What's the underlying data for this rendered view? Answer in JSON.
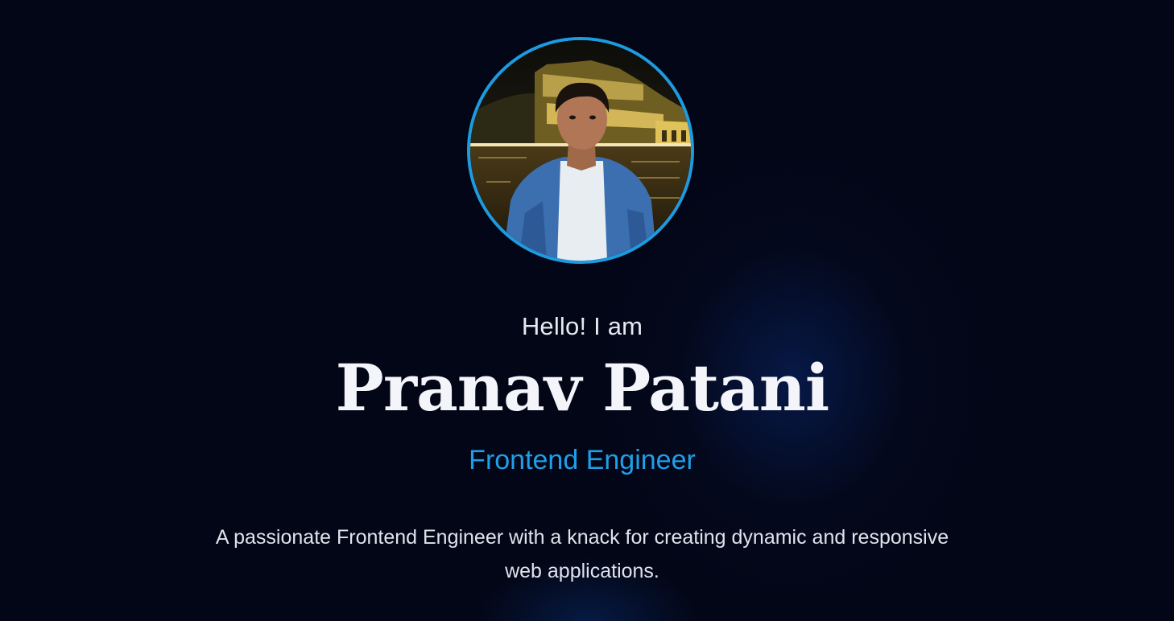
{
  "hero": {
    "greeting": "Hello! I am",
    "name": "Pranav Patani",
    "role": "Frontend Engineer",
    "bio": "A passionate Frontend Engineer with a knack for creating dynamic and responsive web applications.",
    "avatar_icon": "profile-photo"
  },
  "colors": {
    "background": "#030616",
    "accent": "#1f9fe8",
    "heading": "#f4f5fa",
    "body_text": "#dfe3ec"
  }
}
